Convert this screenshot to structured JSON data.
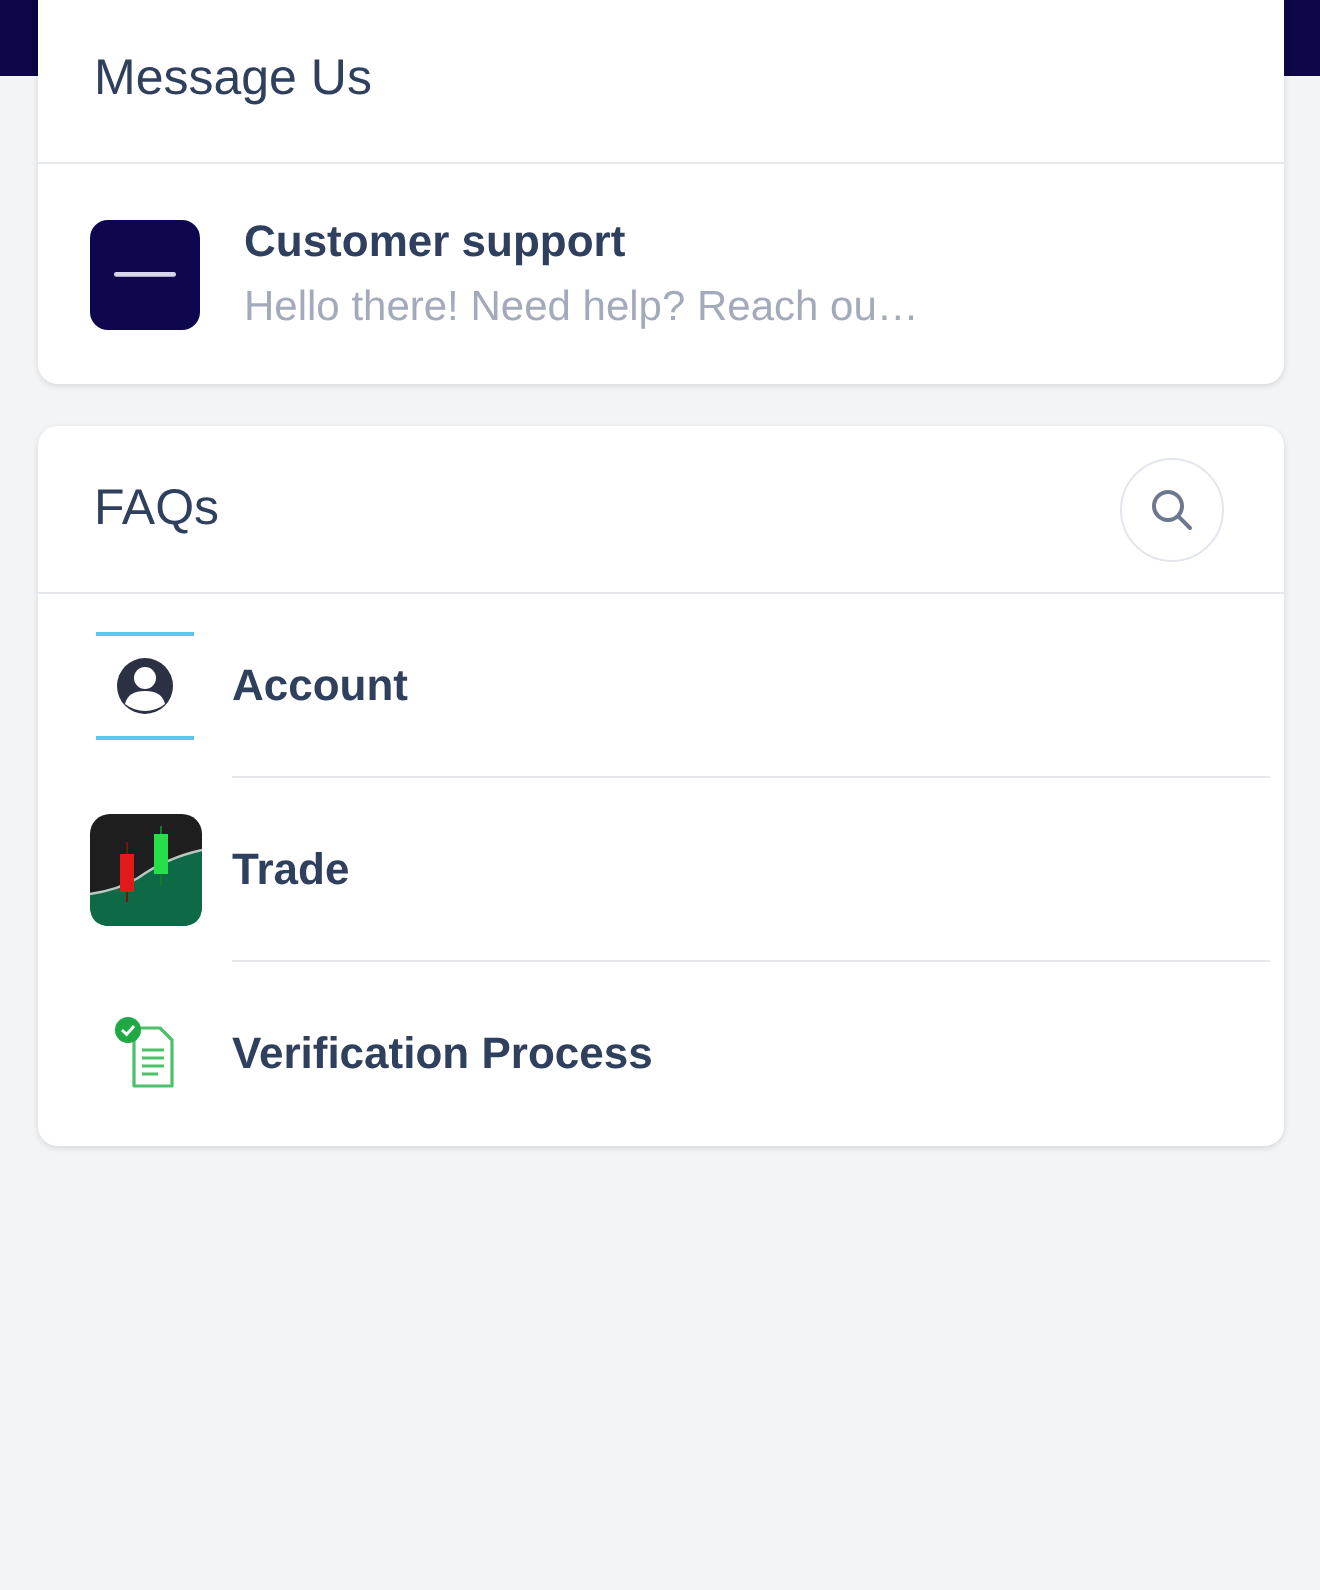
{
  "message_us": {
    "title": "Message Us",
    "conversation": {
      "name": "Customer support",
      "preview": "Hello there! Need help? Reach ou…"
    }
  },
  "faqs": {
    "title": "FAQs",
    "items": [
      {
        "kind": "account",
        "label": "Account"
      },
      {
        "kind": "trade",
        "label": "Trade"
      },
      {
        "kind": "verification",
        "label": "Verification Process"
      }
    ]
  }
}
